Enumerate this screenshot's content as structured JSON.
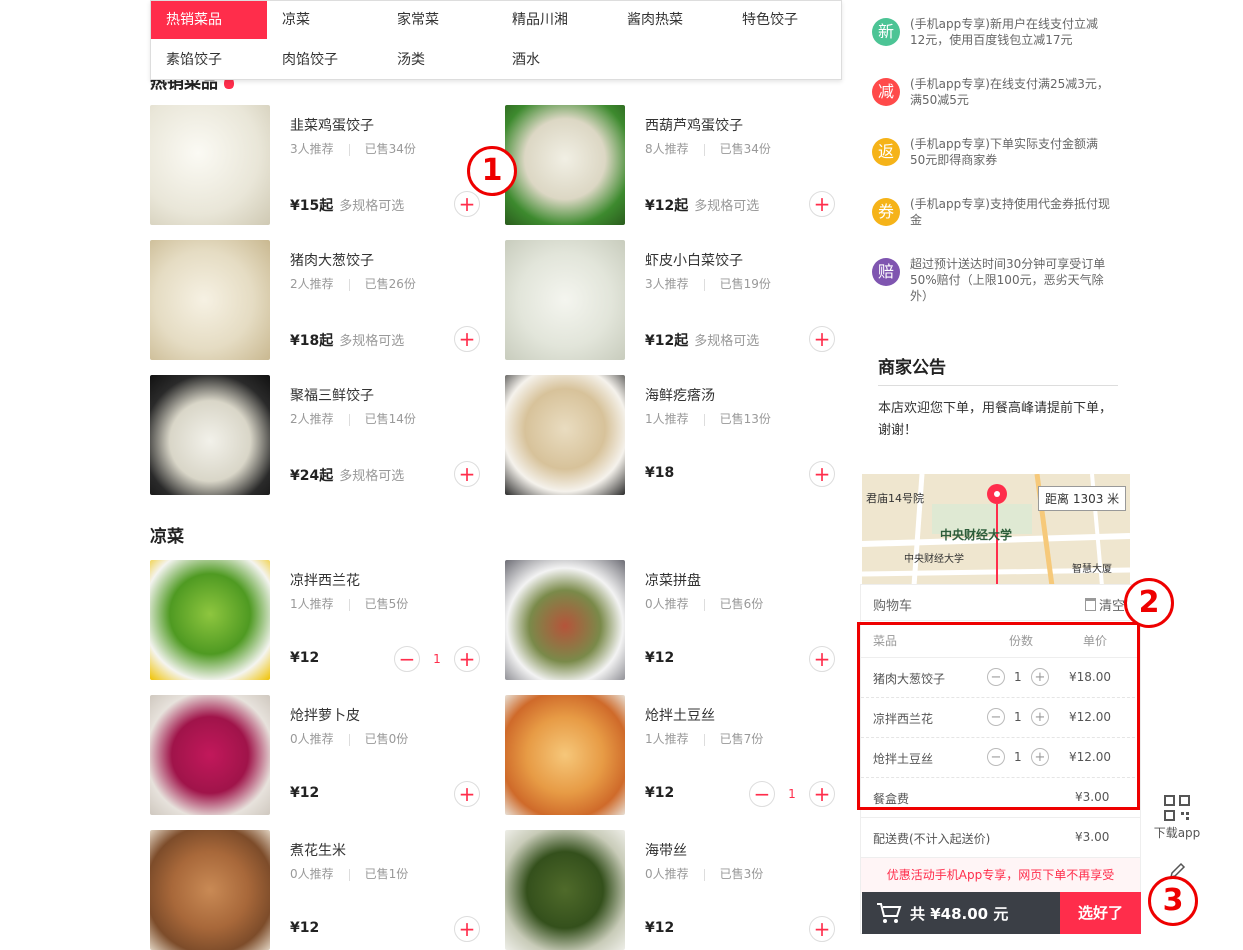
{
  "categories": [
    "热销菜品",
    "凉菜",
    "家常菜",
    "精品川湘",
    "酱肉热菜",
    "特色饺子",
    "素馅饺子",
    "肉馅饺子",
    "汤类",
    "酒水"
  ],
  "sections": {
    "hot_title": "热销菜品",
    "cold_title": "凉菜"
  },
  "items": [
    {
      "name": "韭菜鸡蛋饺子",
      "recommend": "3人推荐",
      "sold": "已售34份",
      "price": "¥15起",
      "spec": "多规格可选",
      "qty": ""
    },
    {
      "name": "西葫芦鸡蛋饺子",
      "recommend": "8人推荐",
      "sold": "已售34份",
      "price": "¥12起",
      "spec": "多规格可选",
      "qty": ""
    },
    {
      "name": "猪肉大葱饺子",
      "recommend": "2人推荐",
      "sold": "已售26份",
      "price": "¥18起",
      "spec": "多规格可选",
      "qty": ""
    },
    {
      "name": "虾皮小白菜饺子",
      "recommend": "3人推荐",
      "sold": "已售19份",
      "price": "¥12起",
      "spec": "多规格可选",
      "qty": ""
    },
    {
      "name": "聚福三鲜饺子",
      "recommend": "2人推荐",
      "sold": "已售14份",
      "price": "¥24起",
      "spec": "多规格可选",
      "qty": ""
    },
    {
      "name": "海鲜疙瘩汤",
      "recommend": "1人推荐",
      "sold": "已售13份",
      "price": "¥18",
      "spec": "",
      "qty": ""
    },
    {
      "name": "凉拌西兰花",
      "recommend": "1人推荐",
      "sold": "已售5份",
      "price": "¥12",
      "spec": "",
      "qty": "1"
    },
    {
      "name": "凉菜拼盘",
      "recommend": "0人推荐",
      "sold": "已售6份",
      "price": "¥12",
      "spec": "",
      "qty": ""
    },
    {
      "name": "炝拌萝卜皮",
      "recommend": "0人推荐",
      "sold": "已售0份",
      "price": "¥12",
      "spec": "",
      "qty": ""
    },
    {
      "name": "炝拌土豆丝",
      "recommend": "1人推荐",
      "sold": "已售7份",
      "price": "¥12",
      "spec": "",
      "qty": "1"
    },
    {
      "name": "煮花生米",
      "recommend": "0人推荐",
      "sold": "已售1份",
      "price": "¥12",
      "spec": "",
      "qty": ""
    },
    {
      "name": "海带丝",
      "recommend": "0人推荐",
      "sold": "已售3份",
      "price": "¥12",
      "spec": "",
      "qty": ""
    }
  ],
  "promos": [
    {
      "badge": "新",
      "color": "#4cc495",
      "text": "(手机app专享)新用户在线支付立减12元，使用百度钱包立减17元"
    },
    {
      "badge": "减",
      "color": "#ff4a4a",
      "text": "(手机app专享)在线支付满25减3元，满50减5元"
    },
    {
      "badge": "返",
      "color": "#f5b319",
      "text": "(手机app专享)下单实际支付金额满50元即得商家券"
    },
    {
      "badge": "券",
      "color": "#f5b319",
      "text": "(手机app专享)支持使用代金券抵付现金"
    },
    {
      "badge": "赔",
      "color": "#7f55b0",
      "text": "超过预计送达时间30分钟可享受订单50%赔付（上限100元，恶劣天气除外）"
    }
  ],
  "notice": {
    "title": "商家公告",
    "text": "本店欢迎您下单，用餐高峰请提前下单，谢谢！"
  },
  "map": {
    "distance": "距离 1303 米",
    "place": "中央财经大学",
    "place_small": "中央财经大学",
    "building": "君庙14号院",
    "building2": "智慧大厦"
  },
  "cart": {
    "title": "购物车",
    "clear": "清空",
    "col_dish": "菜品",
    "col_qty": "份数",
    "col_price": "单价",
    "rows": [
      {
        "name": "猪肉大葱饺子",
        "qty": "1",
        "price": "¥18.00"
      },
      {
        "name": "凉拌西兰花",
        "qty": "1",
        "price": "¥12.00"
      },
      {
        "name": "炝拌土豆丝",
        "qty": "1",
        "price": "¥12.00"
      }
    ],
    "box_fee_label": "餐盒费",
    "box_fee": "¥3.00",
    "delivery_label": "配送费(不计入起送价)",
    "delivery_fee": "¥3.00",
    "promo_note": "优惠活动手机App专享，网页下单不再享受",
    "total": "共 ¥48.00 元",
    "checkout": "选好了"
  },
  "sidetools": {
    "download": "下载app"
  },
  "callouts": [
    "1",
    "2",
    "3"
  ],
  "colors": {
    "accent": "#ff2d4b",
    "dark": "#3b3f46",
    "annotation": "#ee0000"
  }
}
